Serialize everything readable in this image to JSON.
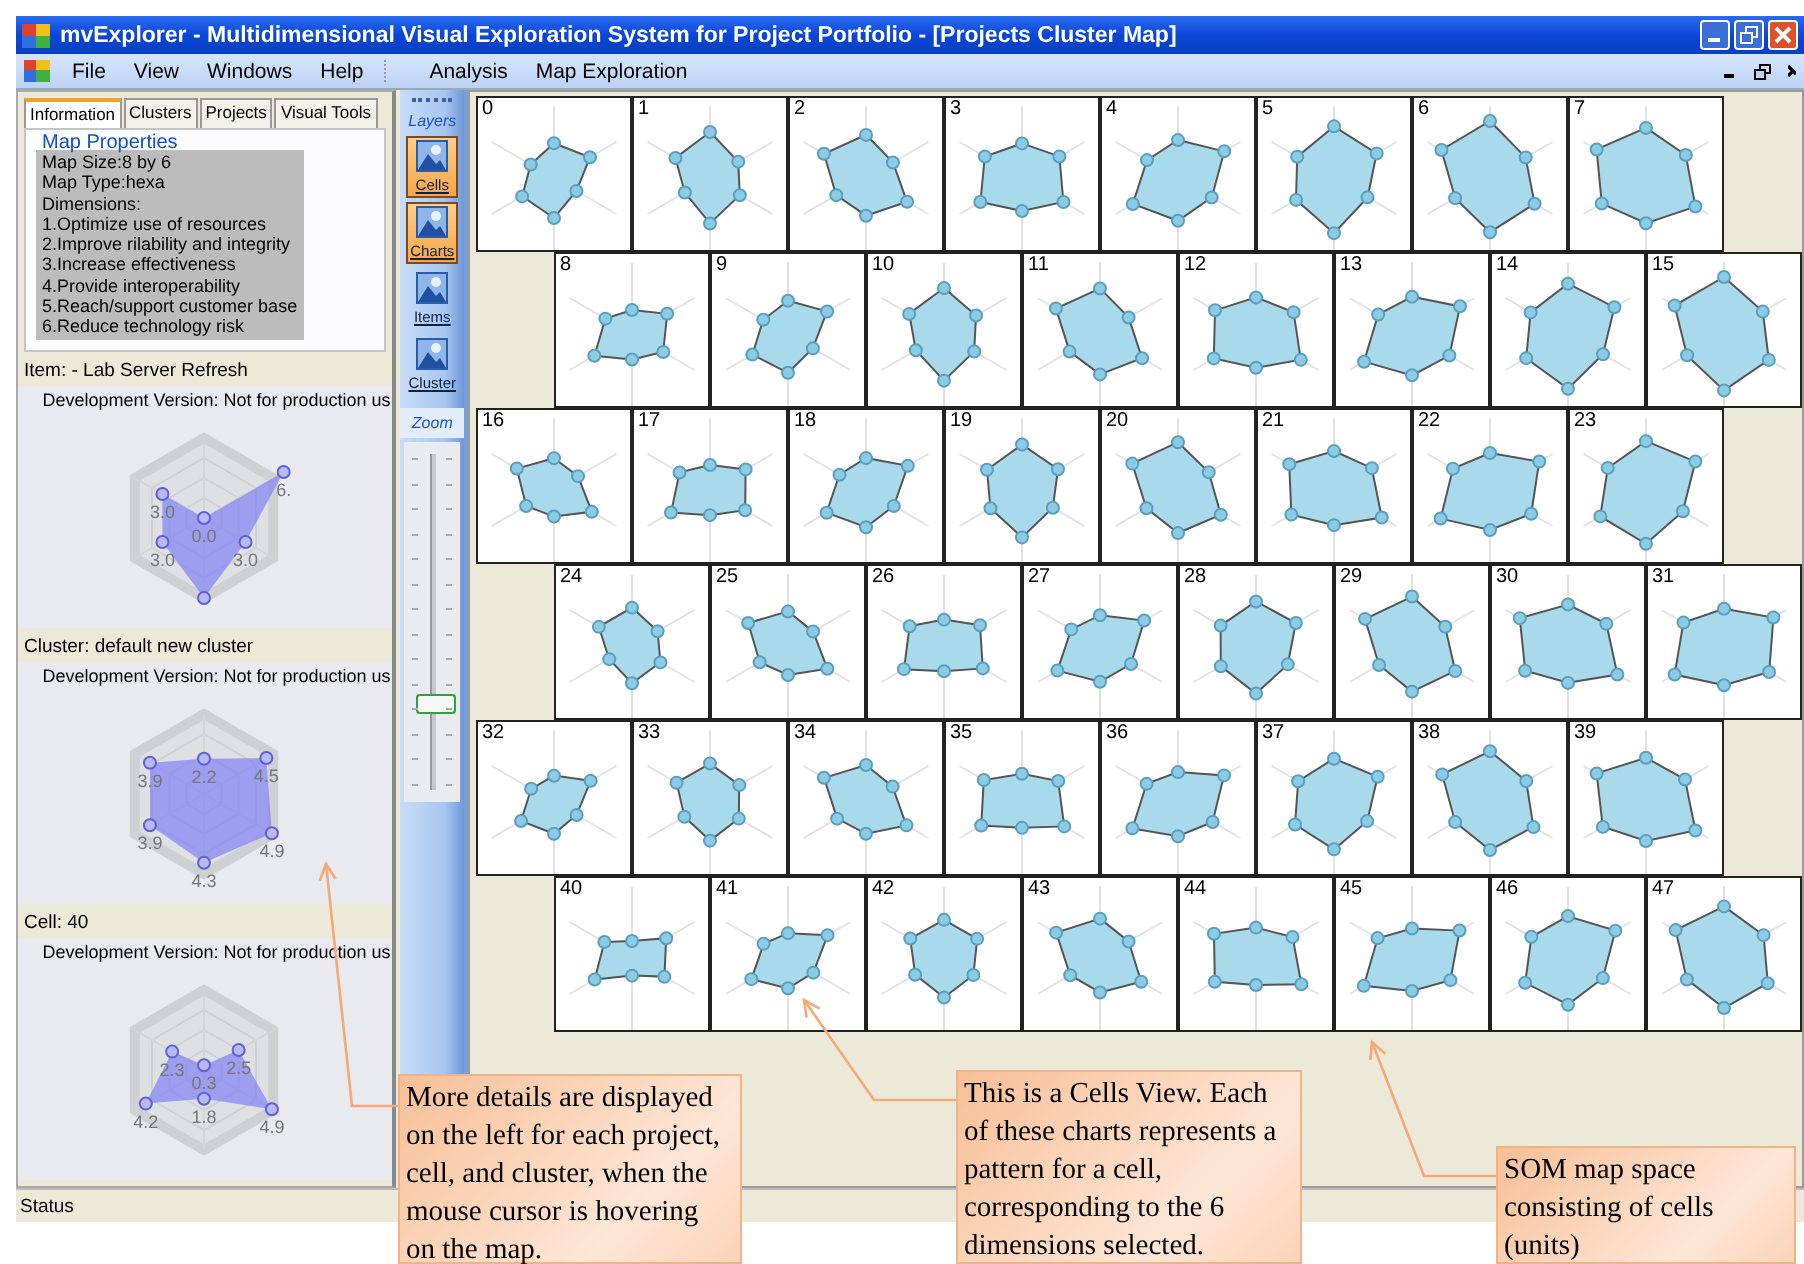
{
  "window": {
    "title": "mvExplorer - Multidimensional Visual Exploration System for Project Portfolio - [Projects Cluster Map]"
  },
  "menu": [
    {
      "kind": "item",
      "label": "File"
    },
    {
      "kind": "item",
      "label": "View"
    },
    {
      "kind": "item",
      "label": "Windows"
    },
    {
      "kind": "item",
      "label": "Help"
    },
    {
      "kind": "separator"
    },
    {
      "kind": "item",
      "label": "Analysis"
    },
    {
      "kind": "item",
      "label": "Map Exploration"
    }
  ],
  "tabs": [
    {
      "label": "Information",
      "selected": true
    },
    {
      "label": "Clusters",
      "selected": false
    },
    {
      "label": "Projects",
      "selected": false
    },
    {
      "label": "Visual Tools",
      "selected": false
    }
  ],
  "map_properties": {
    "title": "Map Properties",
    "lines": [
      "Map Size:8 by 6",
      "Map Type:hexa",
      "Dimensions:",
      "1.Optimize use of resources",
      "2.Improve rilability and integrity",
      "3.Increase effectiveness",
      "4.Provide interoperability",
      "5.Reach/support customer base",
      "6.Reduce technology risk"
    ]
  },
  "detail_panels": [
    {
      "header": "Item: - Lab Server Refresh",
      "chart_title": "Development Version: Not for production us",
      "value_labels": [
        {
          "kind": "top",
          "text": "0.0"
        },
        {
          "kind": "upper_right",
          "text": "6."
        },
        {
          "kind": "lower_right",
          "text": "3.0"
        },
        {
          "kind": "lower_left",
          "text": "3.0"
        },
        {
          "kind": "upper_left",
          "text": "3.0"
        }
      ]
    },
    {
      "header": "Cluster: default new cluster",
      "chart_title": "Development Version: Not for production us",
      "value_labels": [
        {
          "kind": "top",
          "text": "2.2"
        },
        {
          "kind": "upper_right",
          "text": "4.5"
        },
        {
          "kind": "lower_right",
          "text": "4.9"
        },
        {
          "kind": "bottom",
          "text": "4.3"
        },
        {
          "kind": "lower_left",
          "text": "3.9"
        },
        {
          "kind": "upper_left",
          "text": "3.9"
        }
      ]
    },
    {
      "header": "Cell: 40",
      "chart_title": "Development Version: Not for production us",
      "value_labels": [
        {
          "kind": "top",
          "text": "0.3"
        },
        {
          "kind": "upper_right",
          "text": "2.5"
        },
        {
          "kind": "lower_right",
          "text": "4.9"
        },
        {
          "kind": "bottom",
          "text": "1.8"
        },
        {
          "kind": "lower_left",
          "text": "4.2"
        },
        {
          "kind": "upper_left",
          "text": "2.3"
        }
      ]
    }
  ],
  "toolbar": {
    "layers_title": "Layers",
    "buttons": [
      {
        "label": "Cells",
        "selected": true
      },
      {
        "label": "Charts",
        "selected": true
      },
      {
        "label": "Items",
        "selected": false
      },
      {
        "label": "Cluster",
        "selected": false
      }
    ],
    "zoom_title": "Zoom",
    "zoom_slider": {
      "level": 0.25
    }
  },
  "map": {
    "rows": [
      {
        "cells": [
          "0",
          "1",
          "2",
          "3",
          "4",
          "5",
          "6",
          "7"
        ]
      },
      {
        "cells": [
          "8",
          "9",
          "10",
          "11",
          "12",
          "13",
          "14",
          "15"
        ]
      },
      {
        "cells": [
          "16",
          "17",
          "18",
          "19",
          "20",
          "21",
          "22",
          "23"
        ]
      },
      {
        "cells": [
          "24",
          "25",
          "26",
          "27",
          "28",
          "29",
          "30",
          "31"
        ]
      },
      {
        "cells": [
          "32",
          "33",
          "34",
          "35",
          "36",
          "37",
          "38",
          "39"
        ]
      },
      {
        "cells": [
          "40",
          "41",
          "42",
          "43",
          "44",
          "45",
          "46",
          "47"
        ]
      }
    ]
  },
  "status_bar": "Status",
  "callouts": [
    {
      "text": "More details are displayed on the left for each project, cell, and cluster, when the mouse cursor is hovering on the map."
    },
    {
      "text": "This is a Cells View. Each of these charts represents a pattern for a cell, corresponding to the 6 dimensions selected."
    },
    {
      "text": "SOM map space consisting of cells (units)"
    }
  ]
}
